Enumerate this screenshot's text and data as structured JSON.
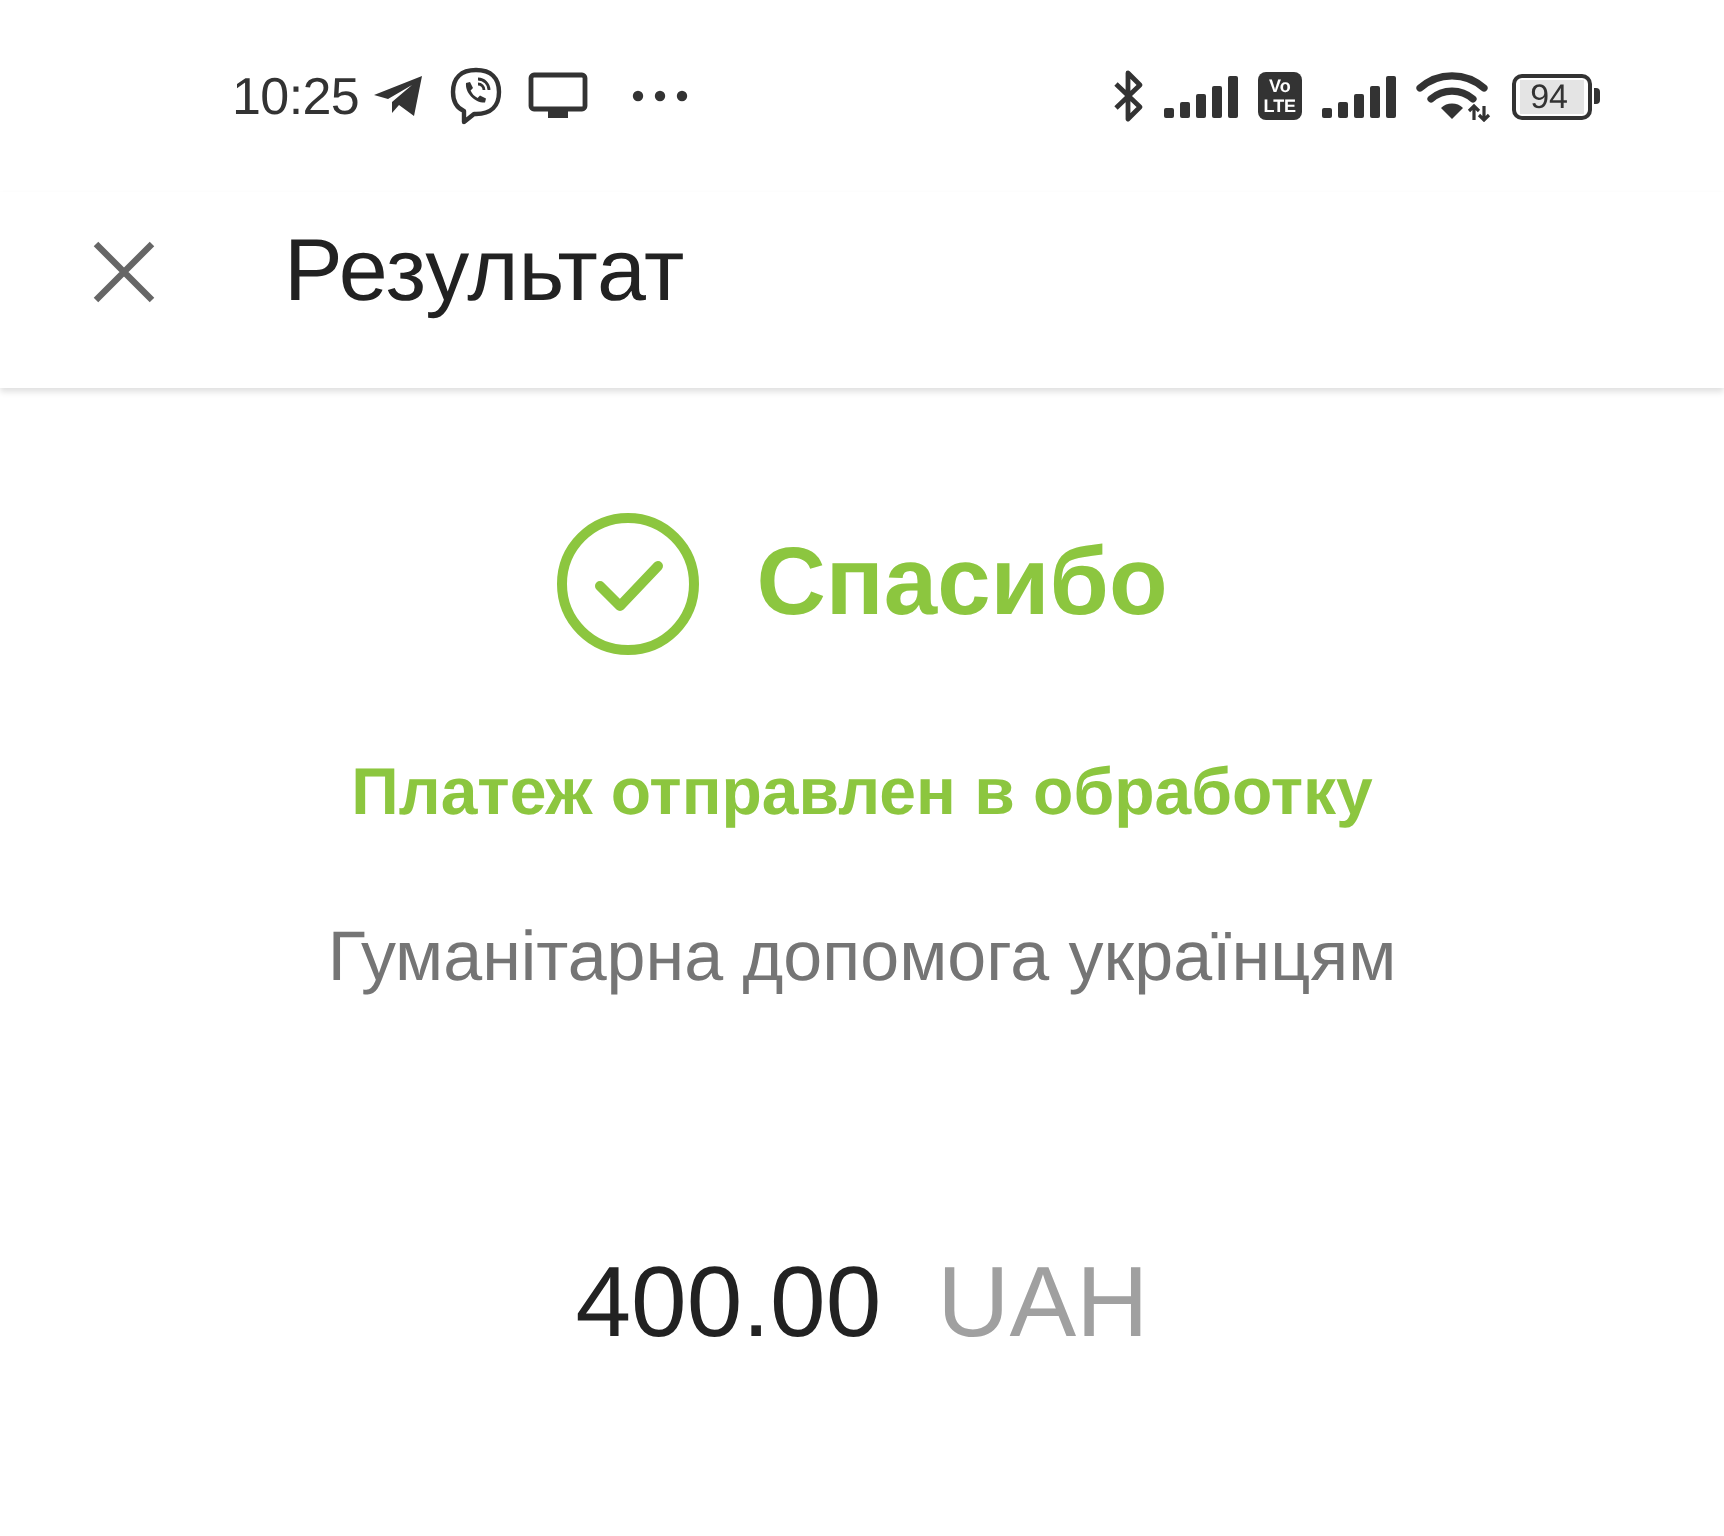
{
  "status_bar": {
    "time": "10:25",
    "network_badge": [
      "Vo",
      "LTE"
    ],
    "battery": "94"
  },
  "app_bar": {
    "title": "Результат"
  },
  "result": {
    "kind": "success",
    "title": "Спасибо",
    "message": "Платеж отправлен в обработку",
    "description": "Гуманітарна допомога українцям",
    "amount": "400.00",
    "currency": "UAH"
  }
}
